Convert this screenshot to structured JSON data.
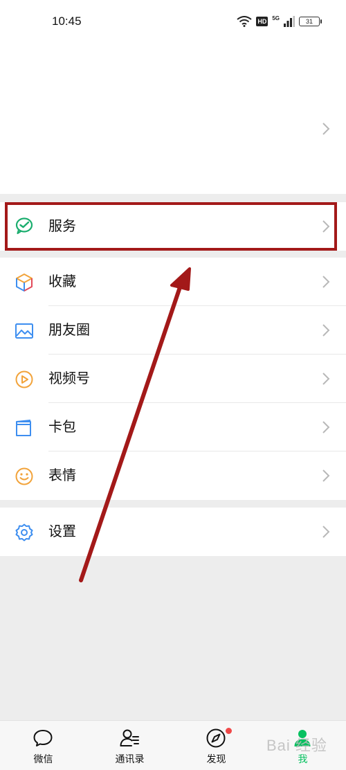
{
  "status_bar": {
    "time": "10:45",
    "network": "5G",
    "hd": "HD",
    "battery": "31"
  },
  "menu": {
    "services": {
      "label": "服务",
      "icon": "wechat-pay-icon"
    },
    "items": [
      {
        "label": "收藏",
        "icon": "favorites-cube-icon"
      },
      {
        "label": "朋友圈",
        "icon": "moments-photo-icon"
      },
      {
        "label": "视频号",
        "icon": "channels-play-icon"
      },
      {
        "label": "卡包",
        "icon": "card-wallet-icon"
      },
      {
        "label": "表情",
        "icon": "sticker-smile-icon"
      }
    ],
    "settings": {
      "label": "设置",
      "icon": "gear-icon"
    }
  },
  "tabs": [
    {
      "label": "微信",
      "icon": "chat-bubble-icon",
      "active": false
    },
    {
      "label": "通讯录",
      "icon": "contacts-icon",
      "active": false
    },
    {
      "label": "发现",
      "icon": "compass-icon",
      "active": false,
      "badge_dot": true
    },
    {
      "label": "我",
      "icon": "person-icon",
      "active": true
    }
  ],
  "watermark": "Bai 经验",
  "colors": {
    "highlight": "#a31919",
    "arrow": "#a31919",
    "wechat_green": "#07c160",
    "badge_red": "#f04848",
    "background": "#ededed"
  }
}
